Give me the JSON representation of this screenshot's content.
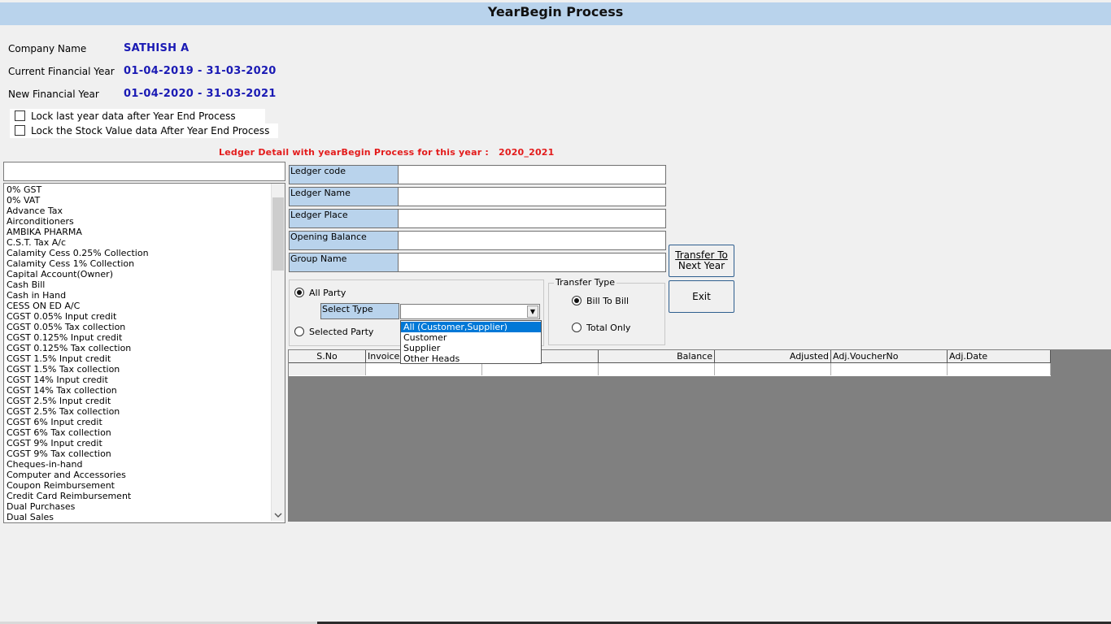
{
  "window": {
    "title": "YearBegin Process"
  },
  "company": {
    "name_label": "Company Name",
    "name_value": "SATHISH A",
    "current_fy_label": "Current Financial Year",
    "current_fy_value": "01-04-2019 - 31-03-2020",
    "new_fy_label": "New Financial Year",
    "new_fy_value": "01-04-2020 - 31-03-2021"
  },
  "options": {
    "lock_last_year": {
      "label": "Lock last year data after Year End Process",
      "checked": false
    },
    "lock_stock_value": {
      "label": "Lock the Stock Value data After Year End Process",
      "checked": false
    }
  },
  "ledger_heading": {
    "text": "Ledger Detail with yearBegin Process for this year :",
    "year": "2020_2021"
  },
  "search": {
    "value": ""
  },
  "ledger_list": [
    "0% GST",
    "0% VAT",
    "Advance Tax",
    "Airconditioners",
    "AMBIKA PHARMA",
    "C.S.T. Tax A/c",
    "Calamity Cess 0.25% Collection",
    "Calamity Cess 1% Collection",
    "Capital Account(Owner)",
    "Cash Bill",
    "Cash in Hand",
    "CESS ON ED A/C",
    "CGST 0.05% Input credit",
    "CGST 0.05% Tax collection",
    "CGST 0.125% Input credit",
    "CGST 0.125% Tax collection",
    "CGST 1.5% Input credit",
    "CGST 1.5% Tax collection",
    "CGST 14% Input credit",
    "CGST 14% Tax collection",
    "CGST 2.5% Input credit",
    "CGST 2.5% Tax collection",
    "CGST 6% Input credit",
    "CGST 6% Tax collection",
    "CGST 9% Input credit",
    "CGST 9% Tax collection",
    "Cheques-in-hand",
    "Computer and Accessories",
    "Coupon Reimbursement",
    "Credit Card Reimbursement",
    "Dual Purchases",
    "Dual Sales"
  ],
  "fields": {
    "ledger_code": {
      "label": "Ledger code",
      "value": ""
    },
    "ledger_name": {
      "label": "Ledger Name",
      "value": ""
    },
    "ledger_place": {
      "label": "Ledger Place",
      "value": ""
    },
    "opening_balance": {
      "label": "Opening Balance",
      "value": ""
    },
    "group_name": {
      "label": "Group Name",
      "value": ""
    }
  },
  "buttons": {
    "transfer_line1": "Transfer To",
    "transfer_line2": "Next Year",
    "exit": "Exit"
  },
  "party": {
    "all_party": "All Party",
    "selected_party": "Selected Party",
    "select_type_label": "Select Type",
    "select_type_value": "",
    "type_options": [
      "All (Customer,Supplier)",
      "Customer",
      "Supplier",
      "Other Heads"
    ],
    "selected_option": "All (Customer,Supplier)"
  },
  "transfer_type": {
    "title": "Transfer Type",
    "bill_to_bill": "Bill To Bill",
    "total_only": "Total Only"
  },
  "grid": {
    "columns": [
      "S.No",
      "Invoice",
      "e",
      "Balance",
      "Adjusted",
      "Adj.VoucherNo",
      "Adj.Date"
    ],
    "rows": []
  },
  "colors": {
    "header_bg": "#b9d3ec",
    "value_blue": "#1a1ab4",
    "heading_red": "#e31b1b",
    "grid_bg": "#808080",
    "selection": "#0078d7"
  }
}
